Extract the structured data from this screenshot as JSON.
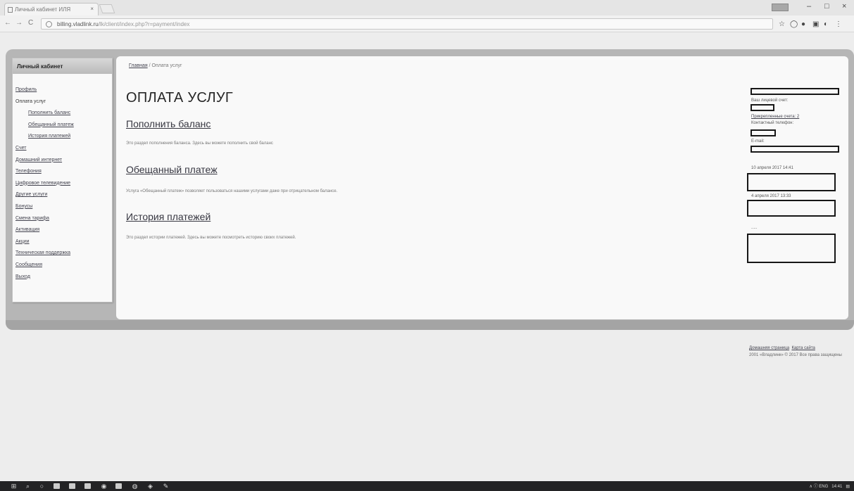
{
  "browser": {
    "tab_title": "Личный кабинет ИЛЯ",
    "tab_close": "×",
    "url_host": "billing.vladlink.ru",
    "url_path": "/lk/client/index.php?r=payment/index",
    "win_min": "–",
    "win_max": "□",
    "win_close": "×",
    "back": "←",
    "forward": "→",
    "reload": "C"
  },
  "sidebar": {
    "title": "Личный кабинет",
    "items": [
      {
        "label": "Профиль",
        "link": true
      },
      {
        "label": "Оплата услуг",
        "link": false
      },
      {
        "label": "Пополнить баланс",
        "link": true,
        "sub": true
      },
      {
        "label": "Обещанный платеж",
        "link": true,
        "sub": true
      },
      {
        "label": "История платежей",
        "link": true,
        "sub": true
      },
      {
        "label": "Счет",
        "link": true
      },
      {
        "label": "Домашний интернет",
        "link": true
      },
      {
        "label": "Телефония",
        "link": true
      },
      {
        "label": "Цифровое телевидение",
        "link": true
      },
      {
        "label": "Другие услуги",
        "link": true
      },
      {
        "label": "Бонусы",
        "link": true
      },
      {
        "label": "Смена тарифа",
        "link": true
      },
      {
        "label": "Активация",
        "link": true
      },
      {
        "label": "Акции",
        "link": true
      },
      {
        "label": "Техническая поддержка",
        "link": true
      },
      {
        "label": "Сообщения",
        "link": true
      },
      {
        "label": "Выход",
        "link": true
      }
    ]
  },
  "main": {
    "breadcrumb_home": "Главная",
    "breadcrumb_sep": " / ",
    "breadcrumb_current": "Оплата услуг",
    "title": "ОПЛАТА УСЛУГ",
    "sections": [
      {
        "heading": "Пополнить баланс",
        "text": "Это раздел пополнения баланса. Здесь вы можете пополнить свой баланс"
      },
      {
        "heading": "Обещанный платеж",
        "text": "Услуга «Обещанный платеж» позволяет пользоваться нашими услугами даже при отрицательном балансе."
      },
      {
        "heading": "История платежей",
        "text": "Это раздел истории платежей. Здесь вы можете посмотреть историю своих платежей."
      }
    ]
  },
  "right_panel": {
    "label_account": "Ваш лицевой счет:",
    "link_linked": "Прикрепленные счета: 2",
    "label_phone": "Контактный телефон:",
    "label_email": "E-mail:",
    "date1": "10 апреля 2017 14:41",
    "date2": "4 апреля 2017 13:33",
    "dots": "....."
  },
  "footer": {
    "link_home": "Домашняя страница",
    "link_map": "Карта сайта",
    "copyright": "2001 «Владлинк» © 2017 Все права защищены"
  },
  "taskbar": {
    "tray": "∧  ⓘ  ENG",
    "time": "14:41"
  }
}
